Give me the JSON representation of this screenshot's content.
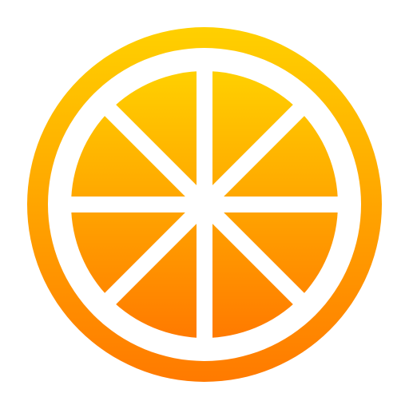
{
  "icon": {
    "name": "orange-slice-icon",
    "segments": 8
  },
  "colors": {
    "background": "#ffffff",
    "gradient_top": "#ffd000",
    "gradient_bottom": "#ff7a00",
    "ring_gap": "#ffffff",
    "dividers": "#ffffff"
  }
}
